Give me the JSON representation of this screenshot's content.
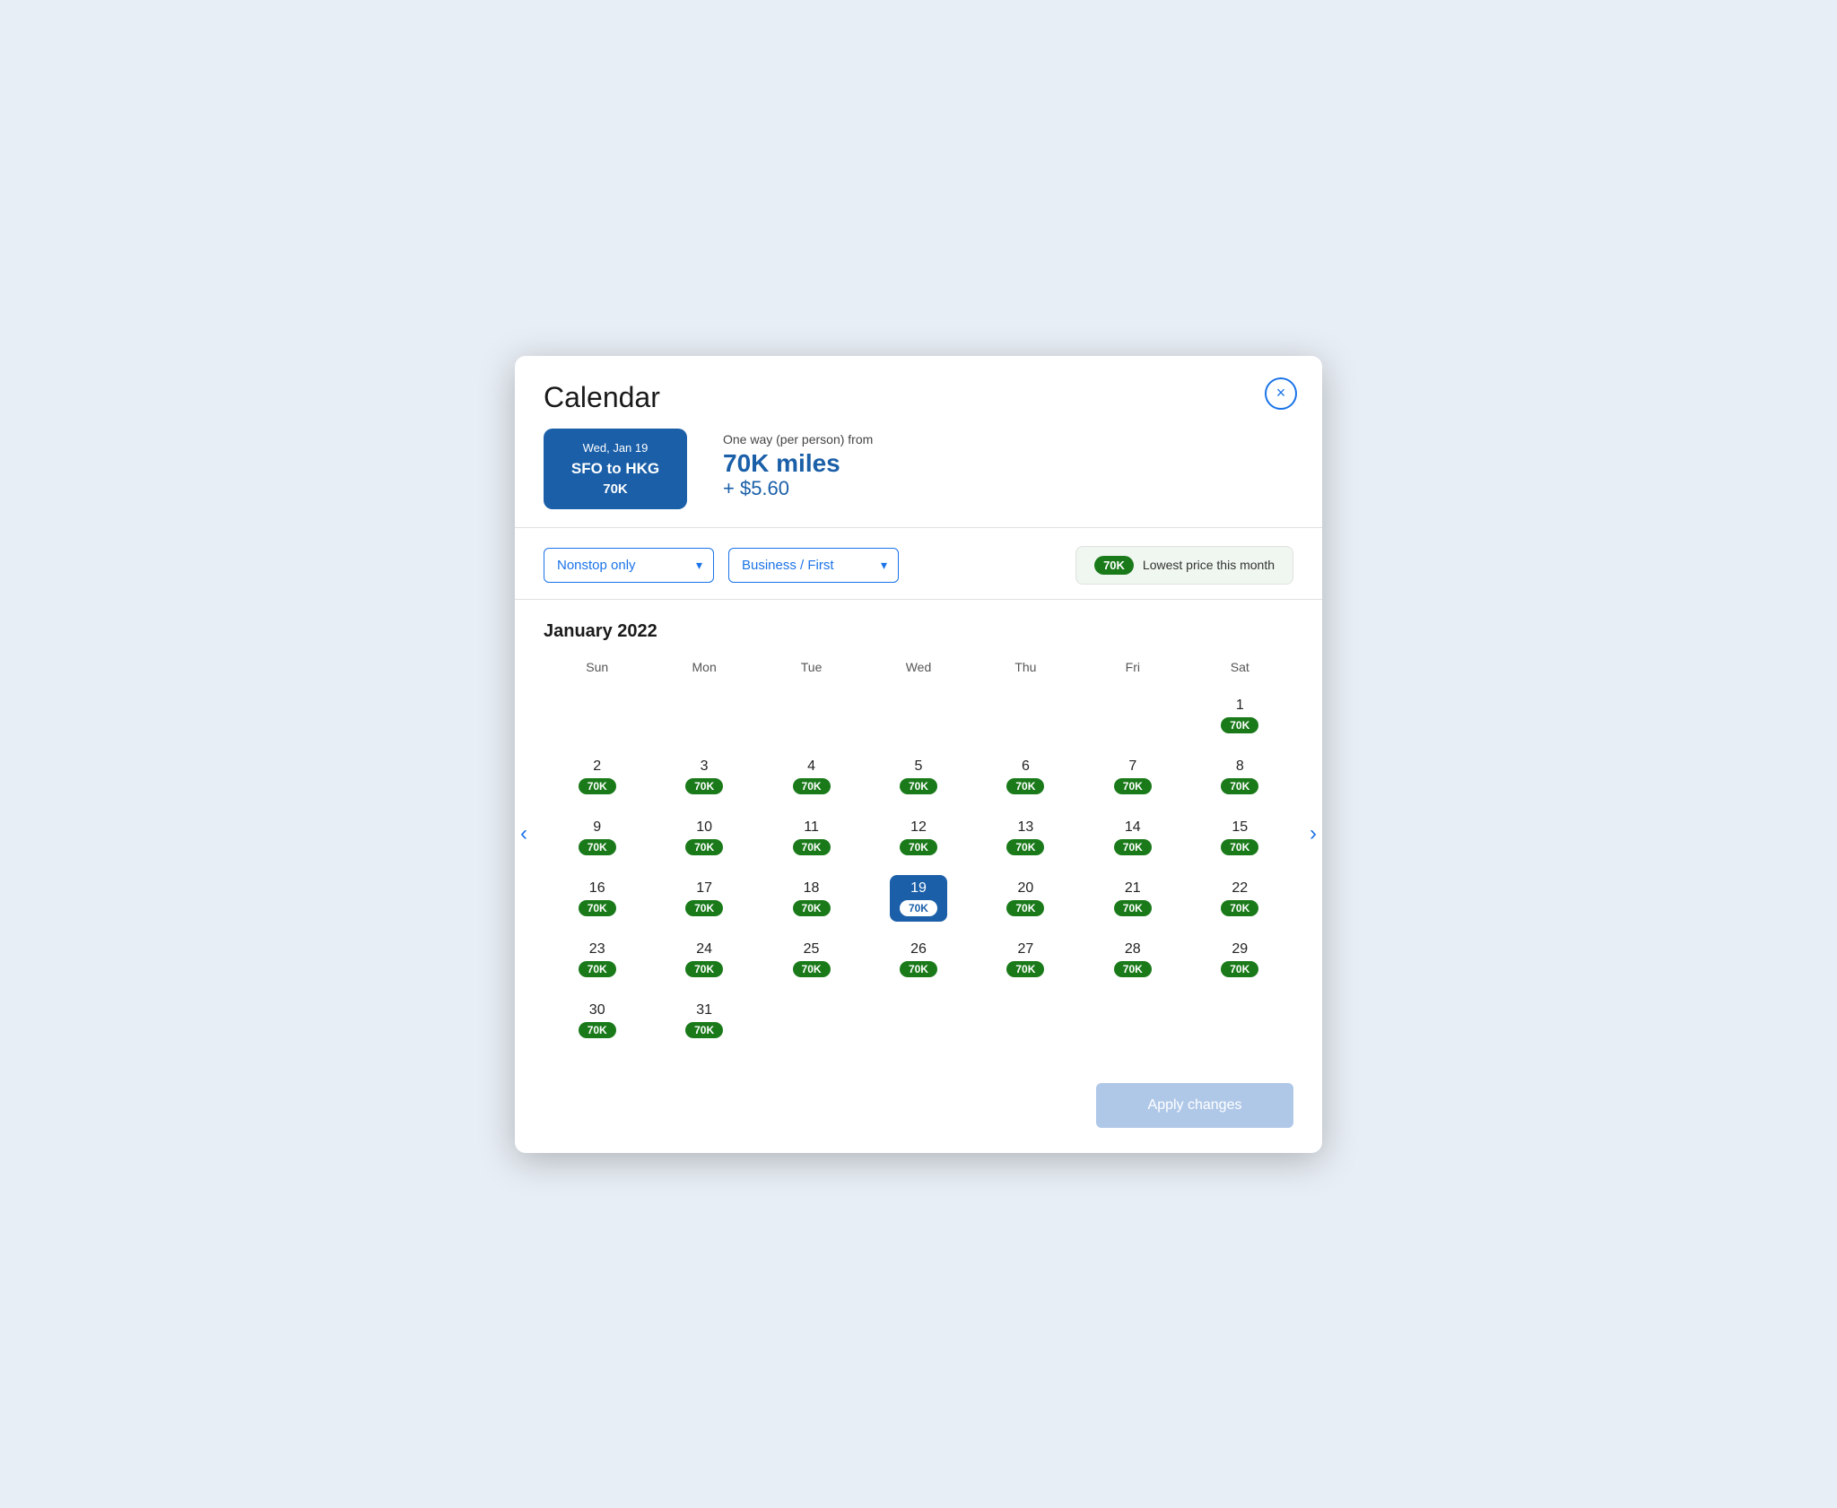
{
  "modal": {
    "title": "Calendar",
    "close_label": "×"
  },
  "flight": {
    "date": "Wed, Jan 19",
    "route": "SFO to HKG",
    "miles_card": "70K"
  },
  "pricing": {
    "label": "One way (per person) from",
    "miles": "70K miles",
    "cash": "+ $5.60"
  },
  "filters": {
    "stops_label": "Nonstop only",
    "class_label": "Business / First",
    "badge_miles": "70K",
    "badge_text": "Lowest price this month"
  },
  "calendar": {
    "month_year": "January 2022",
    "days_of_week": [
      "Sun",
      "Mon",
      "Tue",
      "Wed",
      "Thu",
      "Fri",
      "Sat"
    ],
    "weeks": [
      [
        null,
        null,
        null,
        null,
        null,
        null,
        {
          "day": 1,
          "miles": "70K"
        }
      ],
      [
        {
          "day": 2,
          "miles": "70K"
        },
        {
          "day": 3,
          "miles": "70K"
        },
        {
          "day": 4,
          "miles": "70K"
        },
        {
          "day": 5,
          "miles": "70K"
        },
        {
          "day": 6,
          "miles": "70K"
        },
        {
          "day": 7,
          "miles": "70K"
        },
        {
          "day": 8,
          "miles": "70K"
        }
      ],
      [
        {
          "day": 9,
          "miles": "70K"
        },
        {
          "day": 10,
          "miles": "70K"
        },
        {
          "day": 11,
          "miles": "70K"
        },
        {
          "day": 12,
          "miles": "70K"
        },
        {
          "day": 13,
          "miles": "70K"
        },
        {
          "day": 14,
          "miles": "70K"
        },
        {
          "day": 15,
          "miles": "70K"
        }
      ],
      [
        {
          "day": 16,
          "miles": "70K"
        },
        {
          "day": 17,
          "miles": "70K"
        },
        {
          "day": 18,
          "miles": "70K"
        },
        {
          "day": 19,
          "miles": "70K",
          "selected": true
        },
        {
          "day": 20,
          "miles": "70K"
        },
        {
          "day": 21,
          "miles": "70K"
        },
        {
          "day": 22,
          "miles": "70K"
        }
      ],
      [
        {
          "day": 23,
          "miles": "70K"
        },
        {
          "day": 24,
          "miles": "70K"
        },
        {
          "day": 25,
          "miles": "70K"
        },
        {
          "day": 26,
          "miles": "70K"
        },
        {
          "day": 27,
          "miles": "70K"
        },
        {
          "day": 28,
          "miles": "70K"
        },
        {
          "day": 29,
          "miles": "70K"
        }
      ],
      [
        {
          "day": 30,
          "miles": "70K"
        },
        {
          "day": 31,
          "miles": "70K"
        },
        null,
        null,
        null,
        null,
        null
      ]
    ]
  },
  "footer": {
    "apply_label": "Apply changes"
  }
}
